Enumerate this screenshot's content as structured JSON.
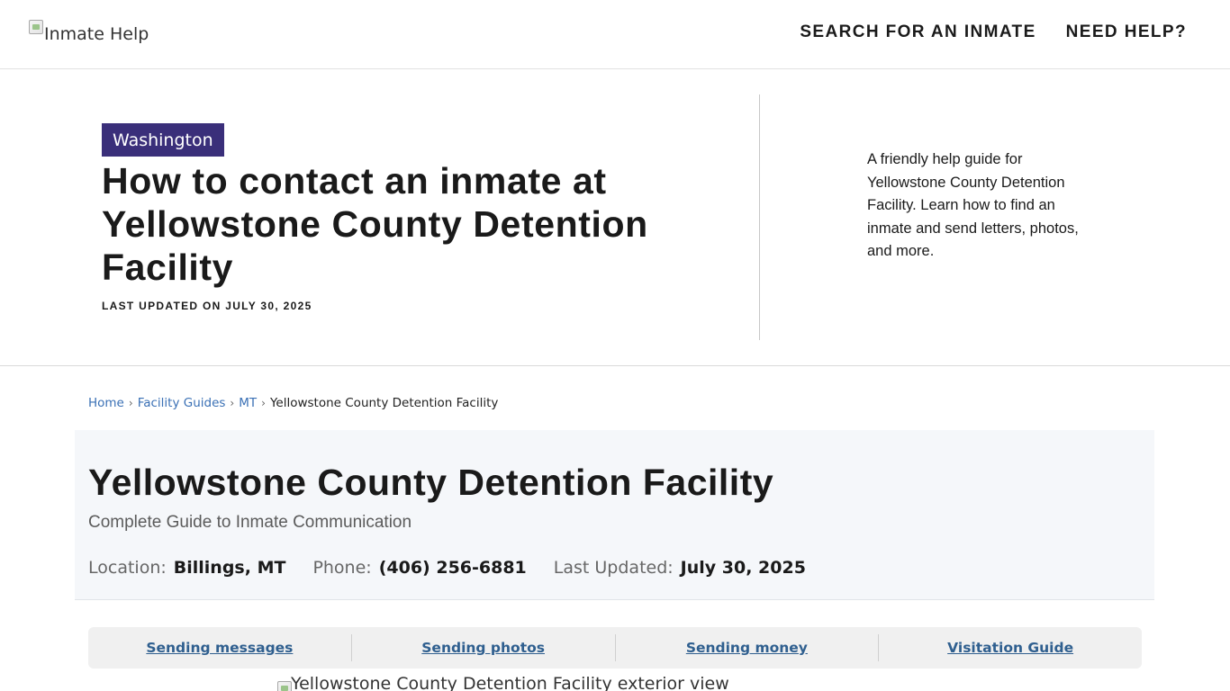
{
  "header": {
    "logo_alt": "Inmate Help",
    "nav": [
      "SEARCH FOR AN INMATE",
      "NEED HELP?"
    ]
  },
  "hero": {
    "state_tag": "Washington",
    "title": "How to contact an inmate at Yellowstone County Detention Facility",
    "last_updated": "LAST UPDATED ON JULY 30, 2025",
    "description": "A friendly help guide for Yellowstone County Detention Facility. Learn how to find an inmate and send letters, photos, and more."
  },
  "breadcrumb": {
    "items": [
      "Home",
      "Facility Guides",
      "MT"
    ],
    "current": "Yellowstone County Detention Facility",
    "separator": "›"
  },
  "facility": {
    "title": "Yellowstone County Detention Facility",
    "subtitle": "Complete Guide to Inmate Communication",
    "location_label": "Location:",
    "location": "Billings, MT",
    "phone_label": "Phone:",
    "phone": "(406) 256-6881",
    "updated_label": "Last Updated:",
    "updated": "July 30, 2025"
  },
  "tabs": [
    "Sending messages",
    "Sending photos",
    "Sending money",
    "Visitation Guide"
  ],
  "exterior_image_alt": "Yellowstone County Detention Facility exterior view",
  "colors": {
    "state_tag_bg": "#3a2f7a",
    "link": "#3a70b5",
    "tab_link": "#2f5f8f",
    "panel_bg": "#f5f7fa"
  }
}
